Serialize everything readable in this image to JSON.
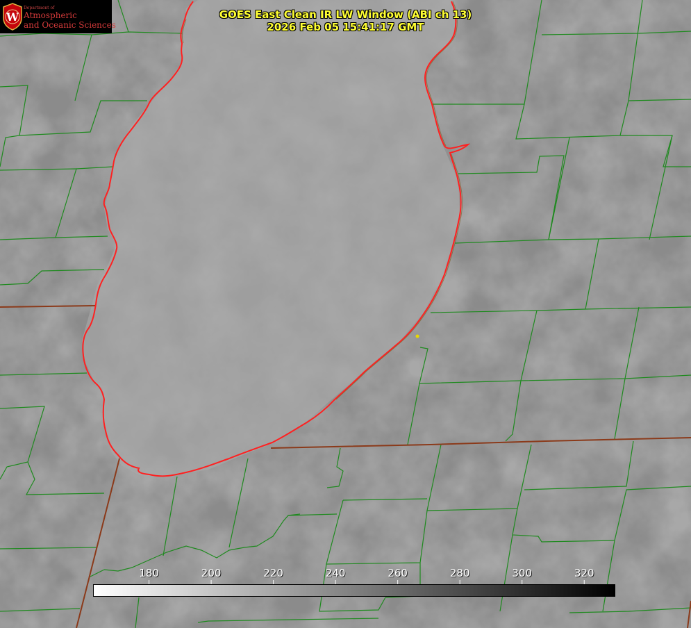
{
  "header": {
    "title": "GOES East Clean IR LW Window (ABI ch 13)",
    "timestamp": "2026 Feb 05 15:41:17 GMT"
  },
  "logo": {
    "department": "Department of",
    "line1": "Atmospheric",
    "line2": "and Oceanic Sciences",
    "seal_letter": "W"
  },
  "colorbar": {
    "ticks": [
      {
        "label": "180",
        "value": 180
      },
      {
        "label": "200",
        "value": 200
      },
      {
        "label": "220",
        "value": 220
      },
      {
        "label": "240",
        "value": 240
      },
      {
        "label": "260",
        "value": 260
      },
      {
        "label": "280",
        "value": 280
      },
      {
        "label": "300",
        "value": 300
      },
      {
        "label": "320",
        "value": 320
      }
    ],
    "range": [
      162,
      330
    ],
    "start_color": "#ffffff",
    "end_color": "#000000"
  },
  "colors": {
    "county_lines": "#1f8a1f",
    "state_lines": "#8b3a1a",
    "lake_outline": "#ff2020",
    "title_text": "#ffff33",
    "marker": "#e8d800"
  }
}
